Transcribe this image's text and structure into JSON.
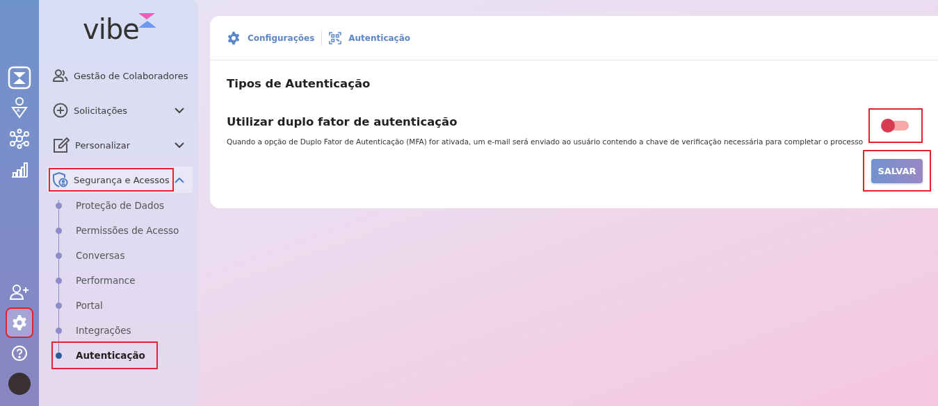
{
  "rail": {
    "items": [
      {
        "kind": "brand",
        "selected": false,
        "highlighted": false
      },
      {
        "kind": "ai-person",
        "selected": false,
        "highlighted": false
      },
      {
        "kind": "network",
        "selected": false,
        "highlighted": false
      },
      {
        "kind": "chart",
        "selected": false,
        "highlighted": false
      },
      {
        "kind": "add-user",
        "selected": false,
        "highlighted": false
      },
      {
        "kind": "settings",
        "selected": true,
        "highlighted": true
      },
      {
        "kind": "help",
        "selected": false,
        "highlighted": false
      },
      {
        "kind": "avatar",
        "selected": false,
        "highlighted": false
      }
    ]
  },
  "sidebar": {
    "logo": "vibe",
    "items": [
      {
        "label": "Gestão de Colaboradores",
        "highlighted": false
      },
      {
        "label": "Solicitações",
        "expanded": false,
        "highlighted": false
      },
      {
        "label": "Personalizar",
        "expanded": false,
        "highlighted": false
      },
      {
        "label": "Segurança e Acessos",
        "expanded": true,
        "highlighted": true,
        "children": [
          {
            "label": "Proteção de Dados",
            "selected": false,
            "highlighted": false
          },
          {
            "label": "Permissões de Acesso",
            "selected": false,
            "highlighted": false
          },
          {
            "label": "Conversas",
            "selected": false,
            "highlighted": false
          },
          {
            "label": "Performance",
            "selected": false,
            "highlighted": false
          },
          {
            "label": "Portal",
            "selected": false,
            "highlighted": false
          },
          {
            "label": "Integrações",
            "selected": false,
            "highlighted": false
          },
          {
            "label": "Autenticação",
            "selected": true,
            "highlighted": true
          }
        ]
      }
    ]
  },
  "breadcrumb": [
    {
      "label": "Configurações"
    },
    {
      "label": "Autenticação"
    }
  ],
  "section_title": "Tipos de Autenticação",
  "setting": {
    "title": "Utilizar duplo fator de autenticação",
    "description": "Quando a opção de Duplo Fator de Autenticação (MFA) for ativada, um e-mail será enviado ao usuário contendo a chave de verificação necessária para completar o processo",
    "on": false,
    "highlighted": true
  },
  "save_button": {
    "label": "SALVAR",
    "highlighted": true
  }
}
